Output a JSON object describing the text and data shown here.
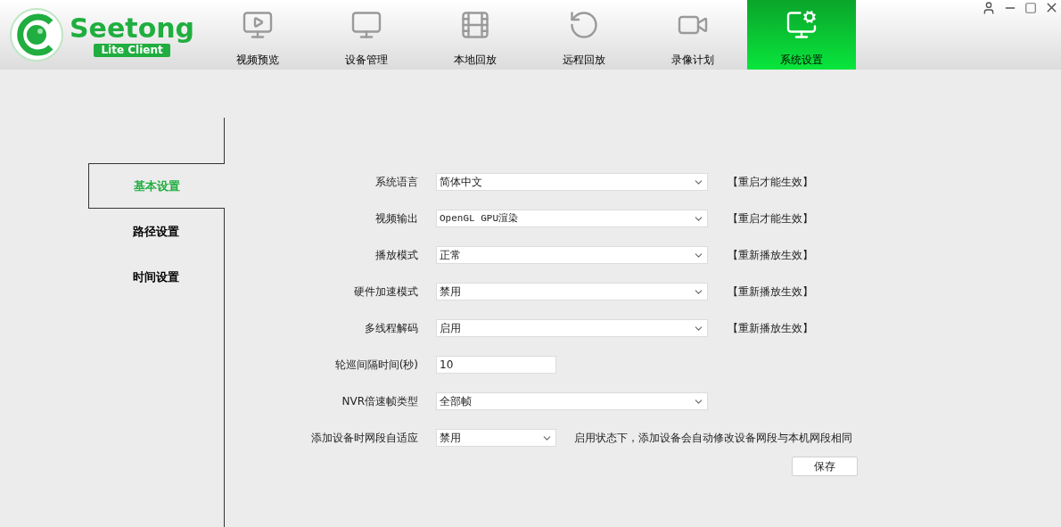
{
  "logo": {
    "name": "Seetong",
    "badge": "Lite Client"
  },
  "tabs": [
    {
      "label": "视频预览",
      "selected": false
    },
    {
      "label": "设备管理",
      "selected": false
    },
    {
      "label": "本地回放",
      "selected": false
    },
    {
      "label": "远程回放",
      "selected": false
    },
    {
      "label": "录像计划",
      "selected": false
    },
    {
      "label": "系统设置",
      "selected": true
    }
  ],
  "sidebar": {
    "items": [
      {
        "label": "基本设置",
        "selected": true
      },
      {
        "label": "路径设置",
        "selected": false
      },
      {
        "label": "时间设置",
        "selected": false
      }
    ]
  },
  "form": {
    "fields": [
      {
        "label": "系统语言",
        "kind": "select",
        "value": "简体中文",
        "note": "【重启才能生效】"
      },
      {
        "label": "视频输出",
        "kind": "select",
        "value": "OpenGL GPU渲染",
        "note": "【重启才能生效】"
      },
      {
        "label": "播放模式",
        "kind": "select",
        "value": "正常",
        "note": "【重新播放生效】"
      },
      {
        "label": "硬件加速模式",
        "kind": "select",
        "value": "禁用",
        "note": "【重新播放生效】"
      },
      {
        "label": "多线程解码",
        "kind": "select",
        "value": "启用",
        "note": "【重新播放生效】"
      },
      {
        "label": "轮巡间隔时间(秒)",
        "kind": "input",
        "value": "10"
      },
      {
        "label": "NVR倍速帧类型",
        "kind": "select",
        "value": "全部帧"
      },
      {
        "label": "添加设备时网段自适应",
        "kind": "select",
        "value": "禁用",
        "hint": "启用状态下，添加设备会自动修改设备网段与本机网段相同"
      }
    ],
    "save": "保存"
  }
}
